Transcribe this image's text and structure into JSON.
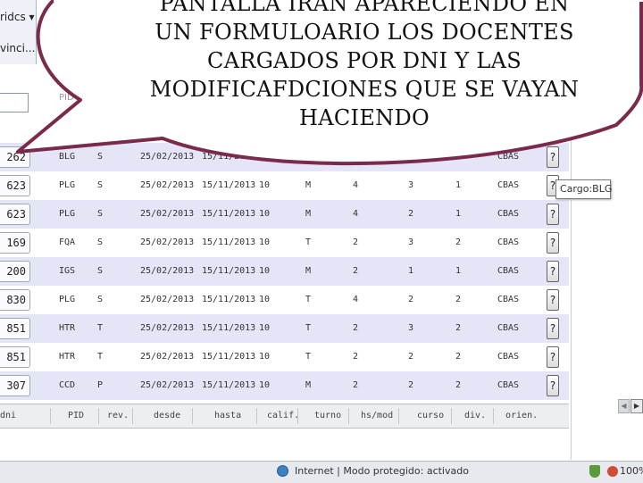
{
  "sidebar": {
    "dropdown_label": "ridcs ▾",
    "provincia_label": "vinci..."
  },
  "filter": {
    "pid_hint": "PID"
  },
  "rows": [
    {
      "dni": "262",
      "pid": "BLG",
      "rev": "S",
      "desde": "25/02/2013",
      "hasta": "15/11/2013",
      "calif": "",
      "turno": "",
      "hs": "",
      "curso": "",
      "div": "",
      "orien": "CBAS",
      "help": "?"
    },
    {
      "dni": "623",
      "pid": "PLG",
      "rev": "S",
      "desde": "25/02/2013",
      "hasta": "15/11/2013",
      "calif": "10",
      "turno": "M",
      "hs": "4",
      "curso": "3",
      "div": "1",
      "orien": "CBAS",
      "help": "?"
    },
    {
      "dni": "623",
      "pid": "PLG",
      "rev": "S",
      "desde": "25/02/2013",
      "hasta": "15/11/2013",
      "calif": "10",
      "turno": "M",
      "hs": "4",
      "curso": "2",
      "div": "1",
      "orien": "CBAS",
      "help": "?"
    },
    {
      "dni": "169",
      "pid": "FQA",
      "rev": "S",
      "desde": "25/02/2013",
      "hasta": "15/11/2013",
      "calif": "10",
      "turno": "T",
      "hs": "2",
      "curso": "3",
      "div": "2",
      "orien": "CBAS",
      "help": "?"
    },
    {
      "dni": "200",
      "pid": "IGS",
      "rev": "S",
      "desde": "25/02/2013",
      "hasta": "15/11/2013",
      "calif": "10",
      "turno": "M",
      "hs": "2",
      "curso": "1",
      "div": "1",
      "orien": "CBAS",
      "help": "?"
    },
    {
      "dni": "830",
      "pid": "PLG",
      "rev": "S",
      "desde": "25/02/2013",
      "hasta": "15/11/2013",
      "calif": "10",
      "turno": "T",
      "hs": "4",
      "curso": "2",
      "div": "2",
      "orien": "CBAS",
      "help": "?"
    },
    {
      "dni": "851",
      "pid": "HTR",
      "rev": "T",
      "desde": "25/02/2013",
      "hasta": "15/11/2013",
      "calif": "10",
      "turno": "T",
      "hs": "2",
      "curso": "3",
      "div": "2",
      "orien": "CBAS",
      "help": "?"
    },
    {
      "dni": "851",
      "pid": "HTR",
      "rev": "T",
      "desde": "25/02/2013",
      "hasta": "15/11/2013",
      "calif": "10",
      "turno": "T",
      "hs": "2",
      "curso": "2",
      "div": "2",
      "orien": "CBAS",
      "help": "?"
    },
    {
      "dni": "307",
      "pid": "CCD",
      "rev": "P",
      "desde": "25/02/2013",
      "hasta": "15/11/2013",
      "calif": "10",
      "turno": "M",
      "hs": "2",
      "curso": "2",
      "div": "2",
      "orien": "CBAS",
      "help": "?"
    }
  ],
  "headers": {
    "dni": "dni",
    "pid": "PID",
    "rev": "rev.",
    "desde": "desde",
    "hasta": "hasta",
    "calif": "calif.",
    "turno": "turno",
    "hs": "hs/mod",
    "curso": "curso",
    "div": "div.",
    "orien": "orien."
  },
  "tooltip": "Cargo:BLG",
  "status": {
    "zone_text": "Internet | Modo protegido: activado",
    "zoom": "100%"
  },
  "caption": {
    "line1": "PANTALLA IRAN APARECIENDO EN",
    "line2": "UN FORMULOARIO LOS DOCENTES",
    "line3": "CARGADOS POR DNI Y LAS",
    "line4": "MODIFICAFDCIONES QUE SE VAYAN",
    "line5": "HACIENDO"
  },
  "colors": {
    "bubble_stroke": "#7a2a4a",
    "row_alt": "#e4e6f8"
  }
}
